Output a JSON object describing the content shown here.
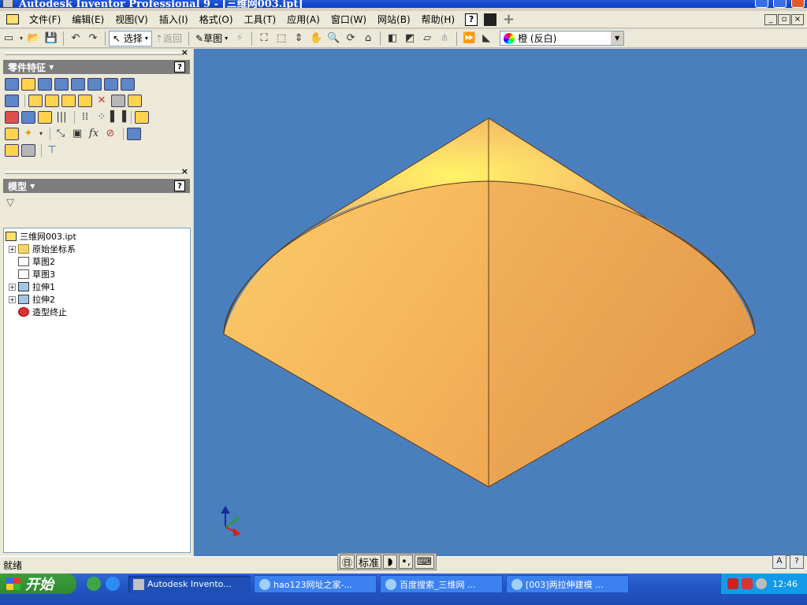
{
  "window": {
    "title": "Autodesk Inventor Professional 9 - [三维网003.ipt]"
  },
  "menu": {
    "items": [
      "文件(F)",
      "编辑(E)",
      "视图(V)",
      "插入(I)",
      "格式(O)",
      "工具(T)",
      "应用(A)",
      "窗口(W)",
      "网站(B)",
      "帮助(H)"
    ]
  },
  "toolbar": {
    "select_label": "选择",
    "return_label": "返回",
    "sketch_label": "草图",
    "color_value": "橙 (反白)"
  },
  "panels": {
    "features_title": "零件特征",
    "model_title": "模型"
  },
  "tree": {
    "items": [
      {
        "label": "三维网003.ipt",
        "icon": "part-icon",
        "expandable": false
      },
      {
        "label": "原始坐标系",
        "icon": "folder-icon",
        "expandable": true
      },
      {
        "label": "草图2",
        "icon": "sketch-icon",
        "expandable": false
      },
      {
        "label": "草图3",
        "icon": "sketch-icon",
        "expandable": false
      },
      {
        "label": "拉伸1",
        "icon": "extrude-icon",
        "expandable": true
      },
      {
        "label": "拉伸2",
        "icon": "extrude-icon",
        "expandable": true
      },
      {
        "label": "造型终止",
        "icon": "end-of-part-icon",
        "expandable": false
      }
    ]
  },
  "status": {
    "text": "就绪"
  },
  "ime": {
    "mode": "标准"
  },
  "taskbar": {
    "start_label": "开始",
    "tasks": [
      {
        "label": "Autodesk Invento...",
        "active": true
      },
      {
        "label": "hao123网址之家-...",
        "active": false
      },
      {
        "label": "百度搜索_三维网 ...",
        "active": false
      },
      {
        "label": "[003]两拉伸建模 ...",
        "active": false
      }
    ],
    "clock": "12:46"
  },
  "colors": {
    "viewport_bg": "#4a7fbd",
    "part_orange": "#f5b45a",
    "title_blue": "#0a3fc4"
  }
}
